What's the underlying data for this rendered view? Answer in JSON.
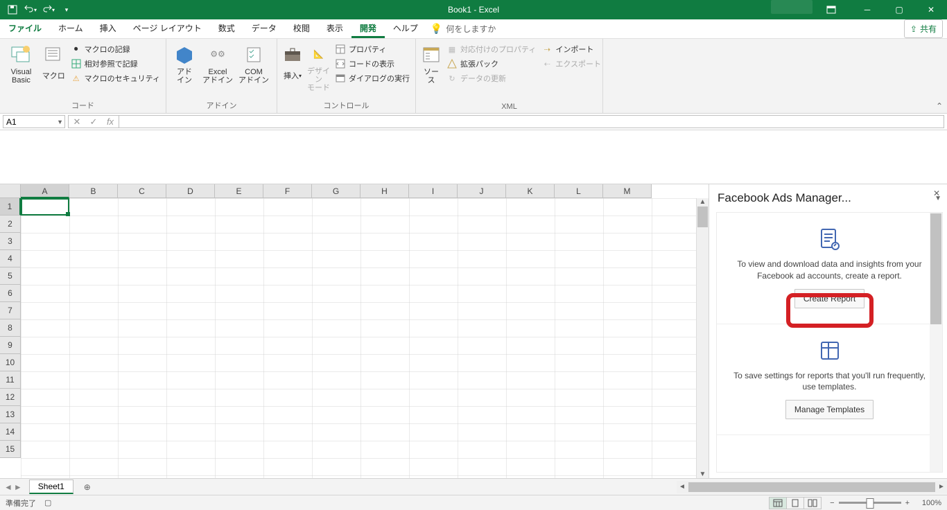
{
  "title": "Book1 - Excel",
  "qat": {
    "save": "save",
    "undo": "undo",
    "redo": "redo"
  },
  "tabs": {
    "file": "ファイル",
    "items": [
      "ホーム",
      "挿入",
      "ページ レイアウト",
      "数式",
      "データ",
      "校閲",
      "表示",
      "開発",
      "ヘルプ"
    ],
    "active_index": 7,
    "tellme": "何をしますか",
    "share": "共有"
  },
  "ribbon": {
    "code": {
      "title": "コード",
      "vb": "Visual Basic",
      "macros": "マクロ",
      "rec_macro": "マクロの記録",
      "rel_ref": "相対参照で記録",
      "security": "マクロのセキュリティ"
    },
    "addins": {
      "title": "アドイン",
      "addins": "アド\nイン",
      "excel_addins": "Excel\nアドイン",
      "com_addins": "COM\nアドイン"
    },
    "controls": {
      "title": "コントロール",
      "insert": "挿入",
      "design": "デザイン\nモード",
      "properties": "プロパティ",
      "view_code": "コードの表示",
      "run_dialog": "ダイアログの実行"
    },
    "xml": {
      "title": "XML",
      "source": "ソース",
      "map_props": "対応付けのプロパティ",
      "expansion": "拡張パック",
      "refresh": "データの更新",
      "import": "インポート",
      "export": "エクスポート"
    }
  },
  "namebox": "A1",
  "columns": [
    "A",
    "B",
    "C",
    "D",
    "E",
    "F",
    "G",
    "H",
    "I",
    "J",
    "K",
    "L",
    "M"
  ],
  "rows": [
    1,
    2,
    3,
    4,
    5,
    6,
    7,
    8,
    9,
    10,
    11,
    12,
    13,
    14,
    15
  ],
  "sheet_tab": "Sheet1",
  "taskpane": {
    "title": "Facebook Ads Manager...",
    "card1_text": "To view and download data and insights from your Facebook ad accounts, create a report.",
    "card1_btn": "Create Report",
    "card2_text": "To save settings for reports that you'll run frequently, use templates.",
    "card2_btn": "Manage Templates"
  },
  "status": {
    "ready": "準備完了",
    "zoom": "100%"
  }
}
